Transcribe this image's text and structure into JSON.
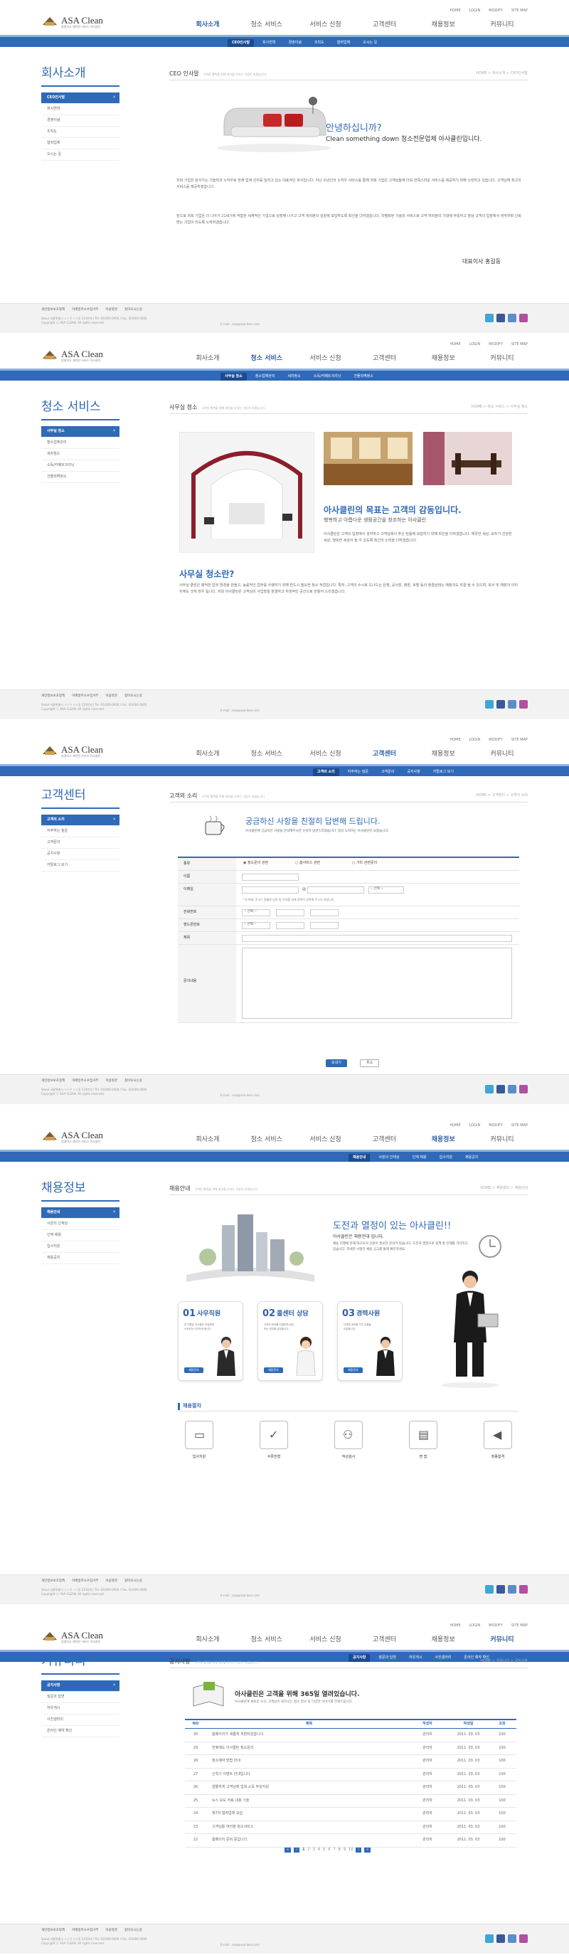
{
  "brand": {
    "name": "ASA Clean",
    "tagline": "청결하고 쾌적한 서비스 아사클린"
  },
  "util": [
    "HOME",
    "LOGIN",
    "MODIFY",
    "SITE MAP"
  ],
  "gnb": [
    "회사소개",
    "청소 서비스",
    "서비스 신청",
    "고객센터",
    "채용정보",
    "커뮤니티"
  ],
  "footer": {
    "links": [
      "개인정보보호정책",
      "이메일주소수집거부",
      "이용약관",
      "찾아오시는길"
    ],
    "address": "Seoul 서울특별시 ㅇㅇ구 ㅇㅇ동 123번지 / Tel. 02)000-0000 / Fax. 02)000-0000",
    "copyright": "Copyright ⓒ ASA CLEAN. All rights reserved.",
    "email": "E-mail : asa@asaclean.com"
  },
  "colors": {
    "primary": "#2f69b8",
    "accent": "#1c4b8f"
  },
  "pages": [
    {
      "side_title": "회사소개",
      "sub": [
        "CEO인사말",
        "회사연혁",
        "경영이념",
        "조직도",
        "협력업체",
        "오시는 길"
      ],
      "content_title": "CEO 인사말",
      "content_desc": "고객의 행복을 위해 최선을 다하는 기업이 되겠습니다.",
      "breadcrumb": "HOME > 회사소개 > CEO인사말",
      "greeting": "안녕하십니까?",
      "greeting_sub": "Clean something down 청소전문업체 아사클린입니다.",
      "paragraphs": [
        "저희 기업은 앞서가는 기술력과 노하우로 현재 업계 선두를 달리고 있는 대표적인 회사입니다. 지난 수년간의 노하우 서비스를 통해 저희 기업은 고객님들께 더욱 만족스러운 서비스를 제공하기 위해 노력하고 있습니다. 고객님께 최고의 서비스를 제공하겠습니다.",
        "앞으로 저희 기업은 더 나아가 21세기에 적합한 세계적인 기업으로 성장해 나가고 고객 여러분의 성원에 보답하도록 최선을 다하겠습니다. 차별화된 기술과 서비스로 고객 여러분의 기대에 부응하고 항상 고객의 입장에서 생각하며 신뢰받는 기업이 되도록 노력하겠습니다."
      ],
      "signature": "대표이사 홍길동"
    },
    {
      "side_title": "청소 서비스",
      "sub": [
        "사무실 청소",
        "청소업체관리",
        "세차청소",
        "소독/카페트크리닝",
        "건물외벽청소"
      ],
      "content_title": "사무실 청소",
      "content_desc": "고객의 행복을 위해 최선을 다하는 기업이 되겠습니다.",
      "breadcrumb": "HOME > 청소 서비스 > 사무실 청소",
      "headline": "아사클린의 목표는 고객의 감동입니다.",
      "headline_sub": "행복하고 아름다운 생활공간을 창조하는 아사클린",
      "intro": "아사클린은 고객의 입장에서 생각하고 고객님께서 주신 믿음에 보답하기 위해 최선을 다하겠습니다. 깨끗한 세상, 모두가 건강한 세상, 행복한 세상이 될 수 있도록 최선의 노력을 다하겠습니다.",
      "section_title": "사무실 청소란?",
      "section_text": "사무실 클린은 쾌적한 업무 환경을 만들고, 능률적인 업무를 수행하기 위해 반드시 필요한 청소 작업입니다. 특히, 고객의 수시로 드나드는 은행, 공사장, 매장, 호텔 등의 청결상태는 매출과도 직결 될 수 있으며, 회사 및 매장의 이미지에도 크게 좌우 됩니다. 저희 아사클린은 고객님의 사업장을 청결하고 위생적인 공간으로 만들어 드리겠습니다."
    },
    {
      "side_title": "고객센터",
      "sub": [
        "고객의 소리",
        "자주하는 질문",
        "고객문의",
        "공지사항",
        "카탈로그 보기"
      ],
      "content_title": "고객의 소리",
      "content_desc": "고객의 행복을 위해 최선을 다하는 기업이 되겠습니다.",
      "breadcrumb": "HOME > 고객센터 > 고객의 소리",
      "headline": "궁금하신 사항을 친절히 답변해 드립니다.",
      "headline_sub": "아사클린에 궁금하신 사항을 문의해주시면 신속히 답변드리겠습니다. 항상 노력하는 아사클린이 되겠습니다.",
      "form_labels": [
        "종류",
        "이름",
        "이메일",
        "전화번호",
        "핸드폰번호",
        "제목",
        "문의내용"
      ],
      "radio_options": [
        "청소문의 관련",
        "홈서비스 관련",
        "기타 관련문의"
      ],
      "email_note": "* E-Mail 주소는 원활한 답변 및 안내를 위해 정확히 입력해 주시기 바랍니다.",
      "select_label": "-- 선택 --",
      "submit_label": "보내기",
      "cancel_label": "취소"
    },
    {
      "side_title": "채용정보",
      "sub": [
        "채용안내",
        "사원의 인재상",
        "인재 채용",
        "입사지원",
        "채용공지"
      ],
      "content_title": "채용안내",
      "content_desc": "고객의 행복을 위해 최선을 다하는 기업이 되겠습니다.",
      "breadcrumb": "HOME > 채용정보 > 채용안내",
      "headline": "도전과 열정이 있는 아사클린!!",
      "headline_sub": "아사클린은 채용전대 입니다.",
      "headline_text": "채용 진행에 현재 대규모의 인원이 필요한 분야가 있습니다. 도전과 열정으로 함께 할 인재를 기다리고 있습니다. 자세한 사항은 채용 공고를 통해 확인하세요.",
      "cards": [
        {
          "num": "01",
          "title": "사무직원",
          "desc": "본 직원은 아사클린 모집부에 소속되어 근무하게 됩니다.",
          "btn": "채용문의"
        },
        {
          "num": "02",
          "title": "콜센터 상담",
          "desc": "고객의 문의를 친절하게 상담하는 업무를 담당합니다.",
          "btn": "채용문의"
        },
        {
          "num": "03",
          "title": "경력사원",
          "desc": "다양한 경력을 가진 분들을 모집합니다.",
          "btn": "채용문의"
        }
      ],
      "process_title": "채용절차",
      "steps": [
        "입사지원",
        "서류전형",
        "적성검사",
        "면 접",
        "최종합격"
      ]
    },
    {
      "side_title": "커뮤니티",
      "sub": [
        "공지사항",
        "질문과 답변",
        "자유게시",
        "사진갤러리",
        "온라인 예약 확인"
      ],
      "content_title": "공지사항",
      "content_desc": "고객의 행복을 위해 최선을 다하는 기업이 되겠습니다.",
      "breadcrumb": "HOME > 커뮤니티 > 공지사항",
      "headline": "아사클린은 고객을 위해 365일 열려있습니다.",
      "headline_sub": "아사클린에 새로운 소식, 고객님이 원하시는 청소 정보 등 다양한 이야기를 전해드립니다.",
      "columns": [
        "NO",
        "제목",
        "작성자",
        "작성일",
        "조회"
      ],
      "rows": [
        {
          "no": "30",
          "title": "홈페이지가 새롭게 개편되었습니다.",
          "author": "관리자",
          "date": "2011. 03. 03",
          "views": "100"
        },
        {
          "no": "29",
          "title": "연휴에도 아사클린 청소문의",
          "author": "관리자",
          "date": "2011. 03. 03",
          "views": "100"
        },
        {
          "no": "28",
          "title": "청소예약 방법 안내",
          "author": "관리자",
          "date": "2011. 03. 03",
          "views": "100"
        },
        {
          "no": "27",
          "title": "신학기 이벤트 안내입니다",
          "author": "관리자",
          "date": "2011. 03. 03",
          "views": "100"
        },
        {
          "no": "26",
          "title": "알뜰하게 고객님께 업데 소독 무상지원",
          "author": "관리자",
          "date": "2011. 03. 03",
          "views": "100"
        },
        {
          "no": "25",
          "title": "뉴스 보도 자료 내용 기술",
          "author": "관리자",
          "date": "2011. 03. 03",
          "views": "100"
        },
        {
          "no": "24",
          "title": "제7차 협력업체 모집",
          "author": "관리자",
          "date": "2011. 03. 03",
          "views": "100"
        },
        {
          "no": "23",
          "title": "고객님들 여러분 청소서비스",
          "author": "관리자",
          "date": "2011. 03. 03",
          "views": "100"
        },
        {
          "no": "22",
          "title": "홈페이지 준비 중입니다.",
          "author": "관리자",
          "date": "2011. 03. 03",
          "views": "100"
        }
      ],
      "pages": [
        "1",
        "2",
        "3",
        "4",
        "5",
        "6",
        "7",
        "8",
        "9",
        "10"
      ]
    }
  ]
}
